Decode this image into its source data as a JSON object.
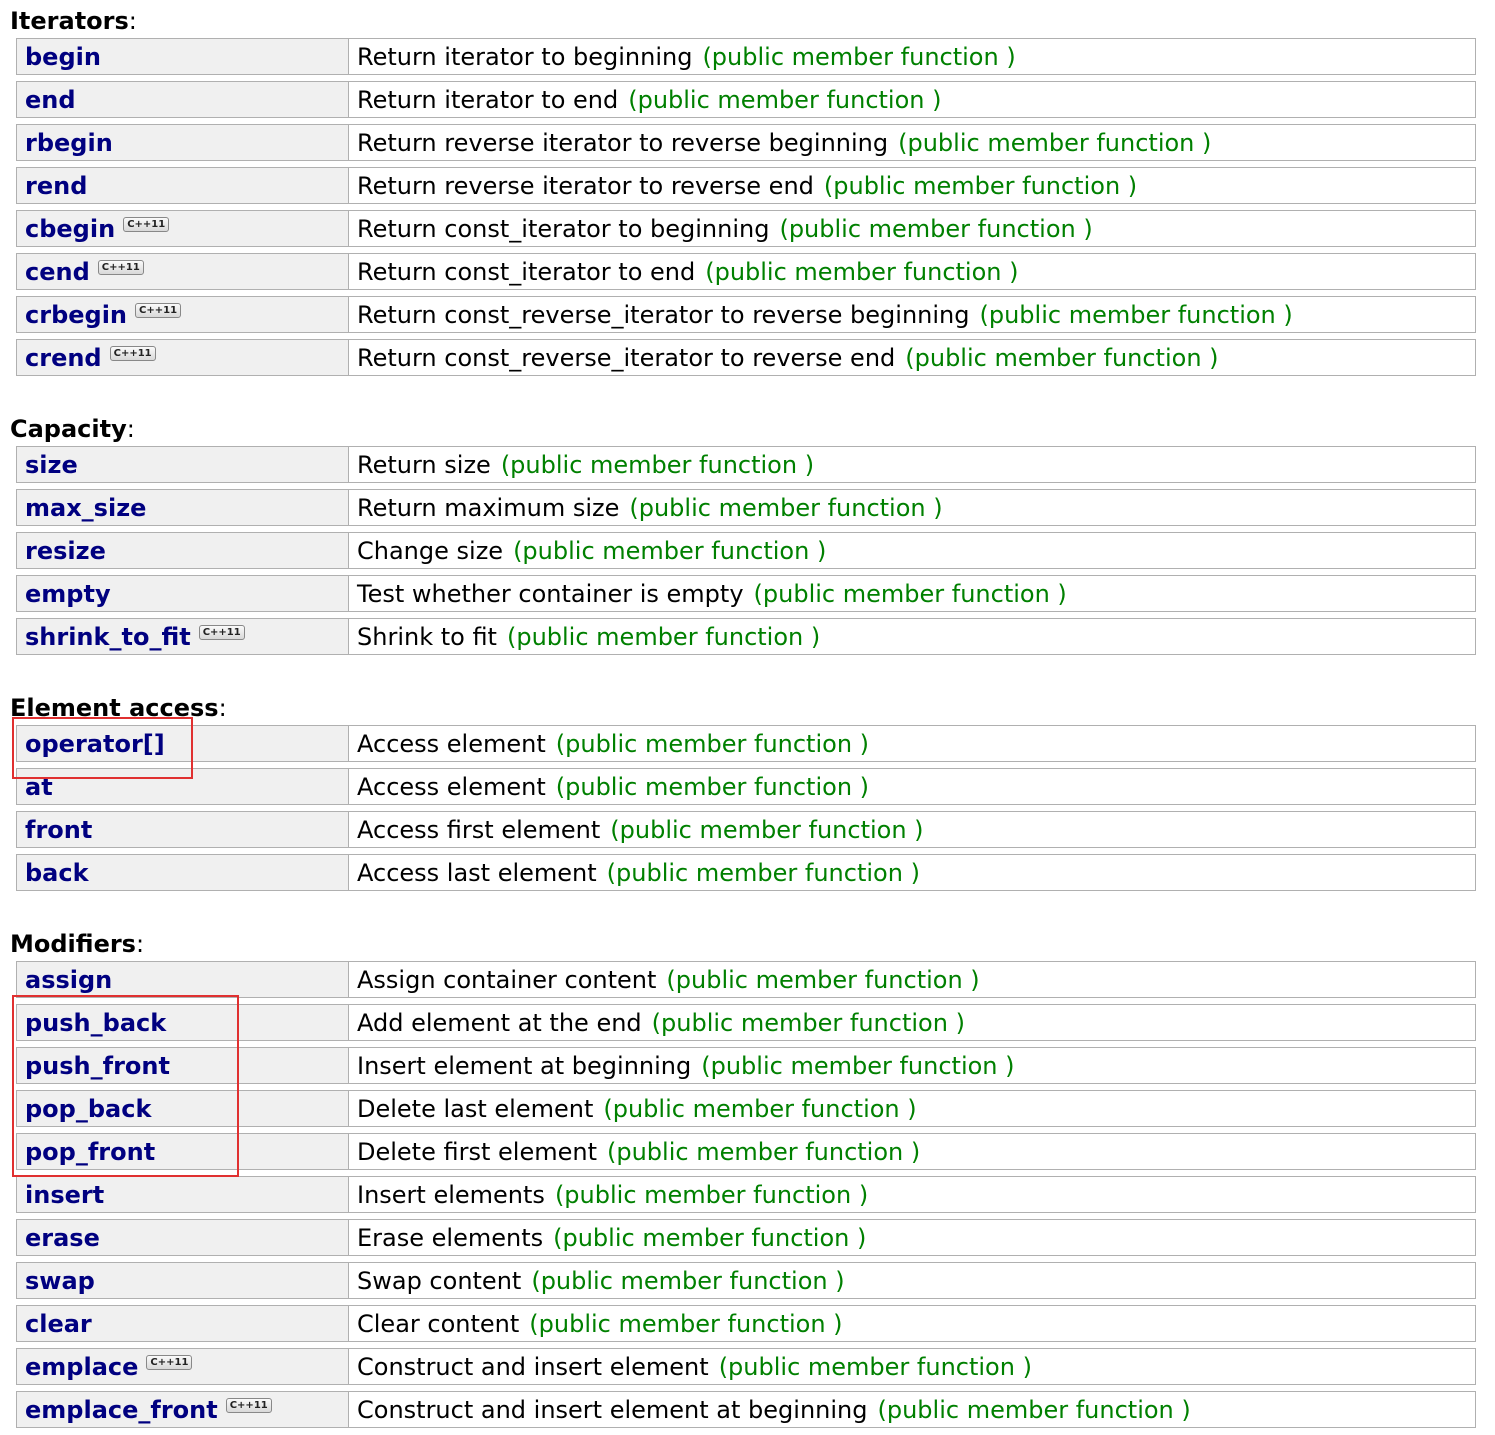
{
  "kind_label": "(public member function )",
  "badge_label": "C++11",
  "sections": [
    {
      "title": "Iterators",
      "colon": ":",
      "rows": [
        {
          "name": "begin",
          "desc": "Return iterator to beginning",
          "cxx11": false
        },
        {
          "name": "end",
          "desc": "Return iterator to end",
          "cxx11": false
        },
        {
          "name": "rbegin",
          "desc": "Return reverse iterator to reverse beginning",
          "cxx11": false
        },
        {
          "name": "rend",
          "desc": "Return reverse iterator to reverse end",
          "cxx11": false
        },
        {
          "name": "cbegin",
          "desc": "Return const_iterator to beginning",
          "cxx11": true
        },
        {
          "name": "cend",
          "desc": "Return const_iterator to end",
          "cxx11": true
        },
        {
          "name": "crbegin",
          "desc": "Return const_reverse_iterator to reverse beginning",
          "cxx11": true
        },
        {
          "name": "crend",
          "desc": "Return const_reverse_iterator to reverse end",
          "cxx11": true
        }
      ]
    },
    {
      "title": "Capacity",
      "colon": ":",
      "rows": [
        {
          "name": "size",
          "desc": "Return size",
          "cxx11": false
        },
        {
          "name": "max_size",
          "desc": "Return maximum size",
          "cxx11": false
        },
        {
          "name": "resize",
          "desc": "Change size",
          "cxx11": false
        },
        {
          "name": "empty",
          "desc": "Test whether container is empty",
          "cxx11": false
        },
        {
          "name": "shrink_to_fit",
          "desc": "Shrink to fit",
          "cxx11": true
        }
      ]
    },
    {
      "title": "Element access",
      "colon": ":",
      "rows": [
        {
          "name": "operator[]",
          "desc": "Access element",
          "cxx11": false
        },
        {
          "name": "at",
          "desc": "Access element",
          "cxx11": false
        },
        {
          "name": "front",
          "desc": "Access first element",
          "cxx11": false
        },
        {
          "name": "back",
          "desc": "Access last element",
          "cxx11": false
        }
      ]
    },
    {
      "title": "Modifiers",
      "colon": ":",
      "rows": [
        {
          "name": "assign",
          "desc": "Assign container content",
          "cxx11": false
        },
        {
          "name": "push_back",
          "desc": "Add element at the end",
          "cxx11": false
        },
        {
          "name": "push_front",
          "desc": "Insert element at beginning",
          "cxx11": false
        },
        {
          "name": "pop_back",
          "desc": "Delete last element",
          "cxx11": false
        },
        {
          "name": "pop_front",
          "desc": "Delete first element",
          "cxx11": false
        },
        {
          "name": "insert",
          "desc": "Insert elements",
          "cxx11": false
        },
        {
          "name": "erase",
          "desc": "Erase elements",
          "cxx11": false
        },
        {
          "name": "swap",
          "desc": "Swap content",
          "cxx11": false
        },
        {
          "name": "clear",
          "desc": "Clear content",
          "cxx11": false
        },
        {
          "name": "emplace",
          "desc": "Construct and insert element",
          "cxx11": true
        },
        {
          "name": "emplace_front",
          "desc": "Construct and insert element at beginning",
          "cxx11": true
        }
      ]
    }
  ],
  "highlight_color": "#e03030",
  "link_color": "#000080",
  "kind_color": "#008000"
}
